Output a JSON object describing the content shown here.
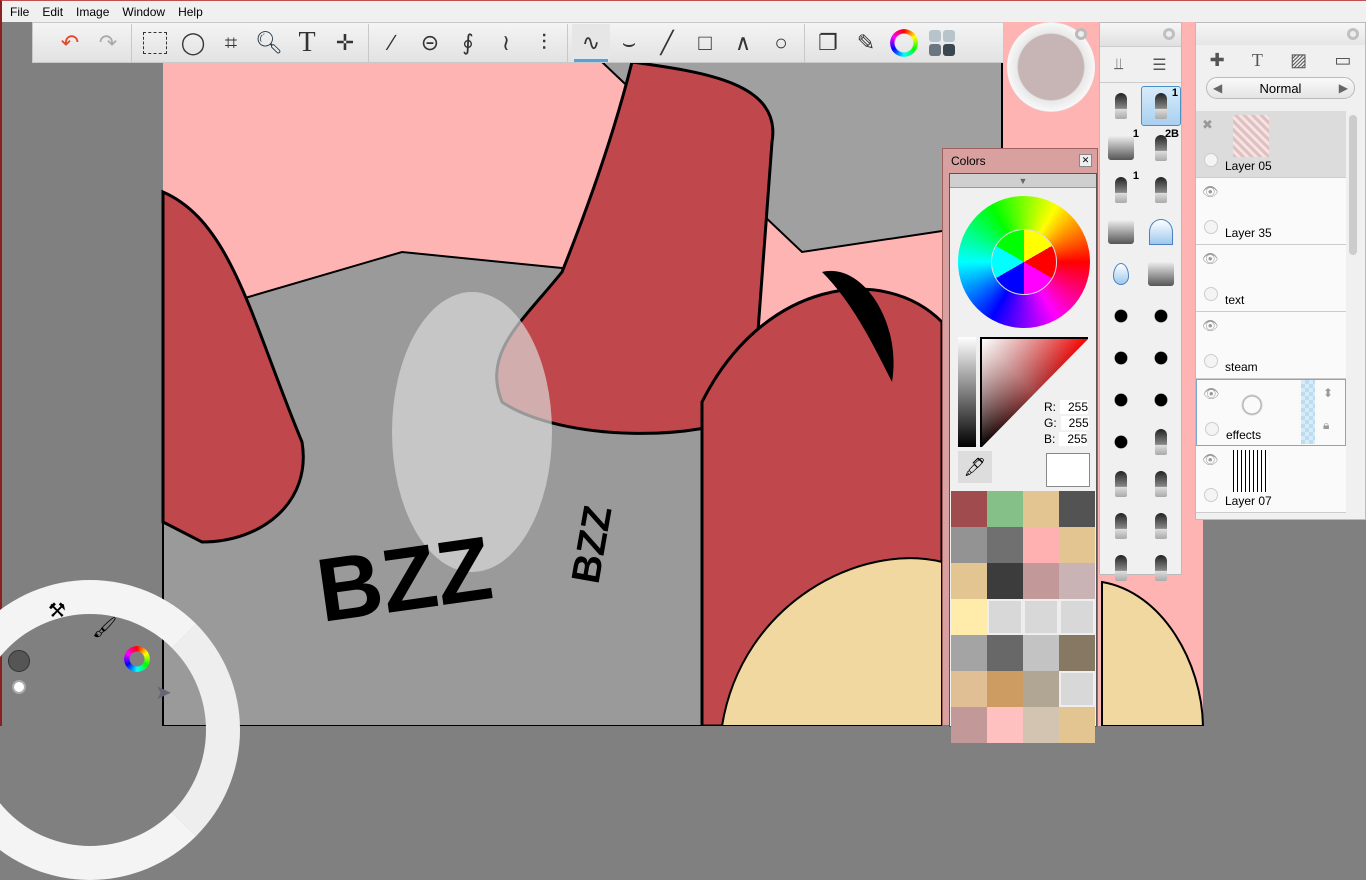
{
  "menu": [
    "File",
    "Edit",
    "Image",
    "Window",
    "Help"
  ],
  "toolbar": {
    "tools": [
      "undo-icon",
      "redo-icon",
      "rect-select-icon",
      "lasso-icon",
      "crop-icon",
      "zoom-icon",
      "text-icon",
      "transform-icon",
      "ruler-icon",
      "ellipse-guide-icon",
      "french-curve-icon",
      "symmetry-x-icon",
      "symmetry-y-icon",
      "freehand-stroke-icon",
      "curve-stroke-icon",
      "line-icon",
      "rectangle-icon",
      "polyline-icon",
      "ellipse-icon",
      "layers-icon",
      "brushes-icon",
      "color-wheel-icon",
      "palette-icon"
    ],
    "active": "freehand-stroke-icon"
  },
  "brushes": {
    "items": [
      {
        "name": "airbrush",
        "n": ""
      },
      {
        "name": "ballpoint-pen",
        "n": "1",
        "selected": true
      },
      {
        "name": "eraser",
        "n": "1"
      },
      {
        "name": "pencil",
        "n": "2B"
      },
      {
        "name": "small-pencil",
        "n": "1"
      },
      {
        "name": "marker",
        "n": ""
      },
      {
        "name": "paint-bucket",
        "n": ""
      },
      {
        "name": "smudge",
        "n": ""
      },
      {
        "name": "water-drop",
        "n": ""
      },
      {
        "name": "hard-eraser",
        "n": ""
      },
      {
        "name": "splatter-1",
        "n": ""
      },
      {
        "name": "splatter-2",
        "n": ""
      },
      {
        "name": "splatter-3",
        "n": ""
      },
      {
        "name": "splatter-4",
        "n": ""
      },
      {
        "name": "splatter-5",
        "n": ""
      },
      {
        "name": "splatter-6",
        "n": ""
      },
      {
        "name": "dots",
        "n": ""
      },
      {
        "name": "ink-marker",
        "n": ""
      },
      {
        "name": "brush-round",
        "n": ""
      },
      {
        "name": "brush-flat",
        "n": ""
      },
      {
        "name": "brush-wide",
        "n": ""
      },
      {
        "name": "brush-angled",
        "n": ""
      },
      {
        "name": "brush-fan",
        "n": ""
      },
      {
        "name": "brush-soft",
        "n": ""
      }
    ]
  },
  "colors": {
    "title": "Colors",
    "r_label": "R:",
    "g_label": "G:",
    "b_label": "B:",
    "r": "255",
    "g": "255",
    "b": "255",
    "current": "#ffffff",
    "swatches": [
      "#a04c4f",
      "#85c088",
      "#e3c591",
      "#535353",
      "#939393",
      "#707070",
      "#ffb0b0",
      "#e3c591",
      "#e3c591",
      "#3c3c3c",
      "#c29898",
      "#c9b3b5",
      "#ffecaa",
      "#d8d8d8",
      "#d8d8d8",
      "#d8d8d8",
      "#a4a4a4",
      "#686868",
      "#c3c3c3",
      "#867862",
      "#e1bf94",
      "#cd9c63",
      "#b1a594",
      "#d8d8d8",
      "#c29898",
      "#ffc0c0",
      "#d2c4b1",
      "#e3c591"
    ]
  },
  "layers": {
    "blend_mode": "Normal",
    "items": [
      {
        "name": "Layer 05",
        "hidden": true
      },
      {
        "name": "Layer 35"
      },
      {
        "name": "text"
      },
      {
        "name": "steam"
      },
      {
        "name": "effects",
        "active": true
      },
      {
        "name": "Layer 07"
      }
    ]
  },
  "canvas": {
    "text": "BZZ"
  }
}
